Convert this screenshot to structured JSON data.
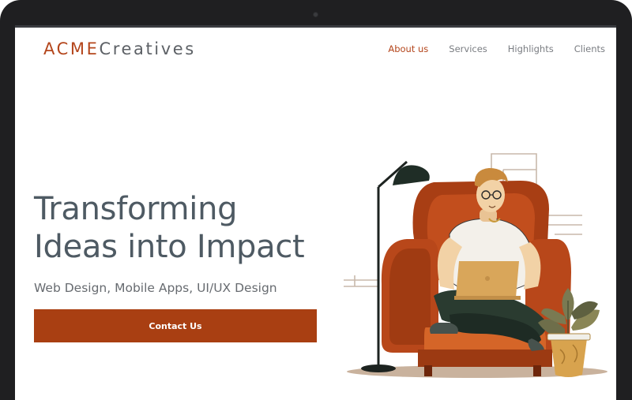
{
  "brand": {
    "part1": "ACME",
    "part2": "Creatives"
  },
  "nav": {
    "items": [
      {
        "label": "About us",
        "active": true
      },
      {
        "label": "Services",
        "active": false
      },
      {
        "label": "Highlights",
        "active": false
      },
      {
        "label": "Clients",
        "active": false
      }
    ]
  },
  "hero": {
    "headline_line1": "Transforming",
    "headline_line2": "Ideas into Impact",
    "subtitle": "Web Design, Mobile Apps, UI/UX Design",
    "cta_label": "Contact Us"
  },
  "colors": {
    "accent": "#a93f12",
    "heading": "#4e5a63",
    "text": "#676b70",
    "frame": "#1f1f21"
  },
  "icons": [
    "camera-icon"
  ]
}
